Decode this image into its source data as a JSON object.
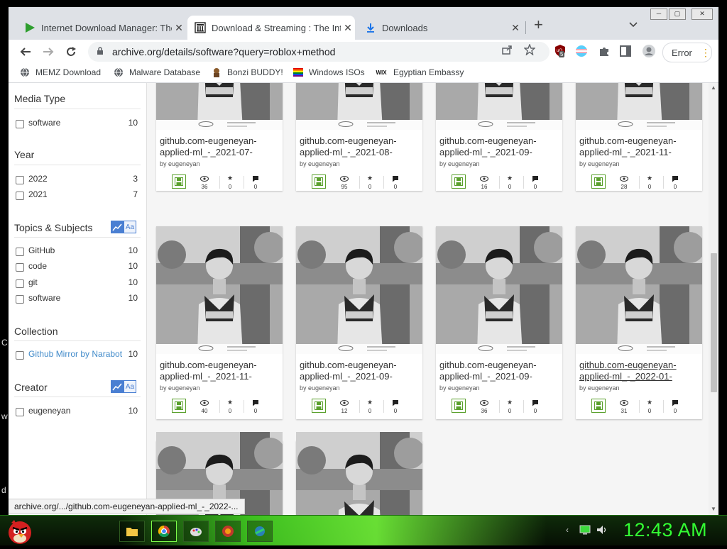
{
  "desktop": {
    "edge_glyphs": [
      "C",
      "w",
      "d"
    ]
  },
  "browser": {
    "tabs": [
      {
        "title": "Internet Download Manager: The",
        "icon": "idm-play-icon"
      },
      {
        "title": "Download & Streaming : The Inte",
        "icon": "archive-org-icon"
      },
      {
        "title": "Downloads",
        "icon": "download-arrow-icon"
      }
    ],
    "new_tab": "+",
    "window_controls": [
      "─",
      "▢",
      "✕"
    ],
    "address": "archive.org/details/software?query=roblox+method",
    "extension_badge": "5",
    "profile_button": "Error",
    "bookmarks": [
      {
        "label": "MEMZ Download",
        "icon": "globe-icon"
      },
      {
        "label": "Malware Database",
        "icon": "globe-icon"
      },
      {
        "label": "Bonzi BUDDY!",
        "icon": "bonzi-icon"
      },
      {
        "label": "Windows ISOs",
        "icon": "rainbow-flag-icon"
      },
      {
        "label": "Egyptian Embassy",
        "icon": "wix-icon"
      }
    ],
    "bookmark_wix_text": "WIX"
  },
  "sidebar": {
    "facets": [
      {
        "title": "Media Type",
        "items": [
          {
            "label": "software",
            "count": "10"
          }
        ]
      },
      {
        "title": "Year",
        "items": [
          {
            "label": "2022",
            "count": "3"
          },
          {
            "label": "2021",
            "count": "7"
          }
        ]
      },
      {
        "title": "Topics & Subjects",
        "icons": true,
        "items": [
          {
            "label": "GitHub",
            "count": "10"
          },
          {
            "label": "code",
            "count": "10"
          },
          {
            "label": "git",
            "count": "10"
          },
          {
            "label": "software",
            "count": "10"
          }
        ]
      },
      {
        "title": "Collection",
        "items": [
          {
            "label": "Github Mirror by Narabot",
            "count": "10"
          }
        ]
      },
      {
        "title": "Creator",
        "icons": true,
        "items": [
          {
            "label": "eugeneyan",
            "count": "10"
          }
        ]
      }
    ],
    "aa_label": "Aa"
  },
  "results": {
    "author": "by eugeneyan",
    "rows": [
      [
        {
          "title": "github.com-eugeneyan-applied-ml_-_2021-07-",
          "views": "36",
          "favs": "0",
          "reviews": "0"
        },
        {
          "title": "github.com-eugeneyan-applied-ml_-_2021-08-",
          "views": "95",
          "favs": "0",
          "reviews": "0"
        },
        {
          "title": "github.com-eugeneyan-applied-ml_-_2021-09-",
          "views": "16",
          "favs": "0",
          "reviews": "0"
        },
        {
          "title": "github.com-eugeneyan-applied-ml_-_2021-11-",
          "views": "28",
          "favs": "0",
          "reviews": "0"
        }
      ],
      [
        {
          "title": "github.com-eugeneyan-applied-ml_-_2021-11-",
          "views": "40",
          "favs": "0",
          "reviews": "0"
        },
        {
          "title": "github.com-eugeneyan-applied-ml_-_2021-09-",
          "views": "12",
          "favs": "0",
          "reviews": "0"
        },
        {
          "title": "github.com-eugeneyan-applied-ml_-_2021-09-",
          "views": "36",
          "favs": "0",
          "reviews": "0"
        },
        {
          "title": "github.com-eugeneyan-applied-ml_-_2022-01-",
          "views": "31",
          "favs": "0",
          "reviews": "0"
        }
      ]
    ]
  },
  "status_url": "archive.org/.../github.com-eugeneyan-applied-ml_-_2022-...",
  "taskbar": {
    "clock": "12:43 AM"
  },
  "colors": {
    "accent_green": "#33ff33",
    "link_blue": "#428bca",
    "download_green": "#5aa02c"
  }
}
